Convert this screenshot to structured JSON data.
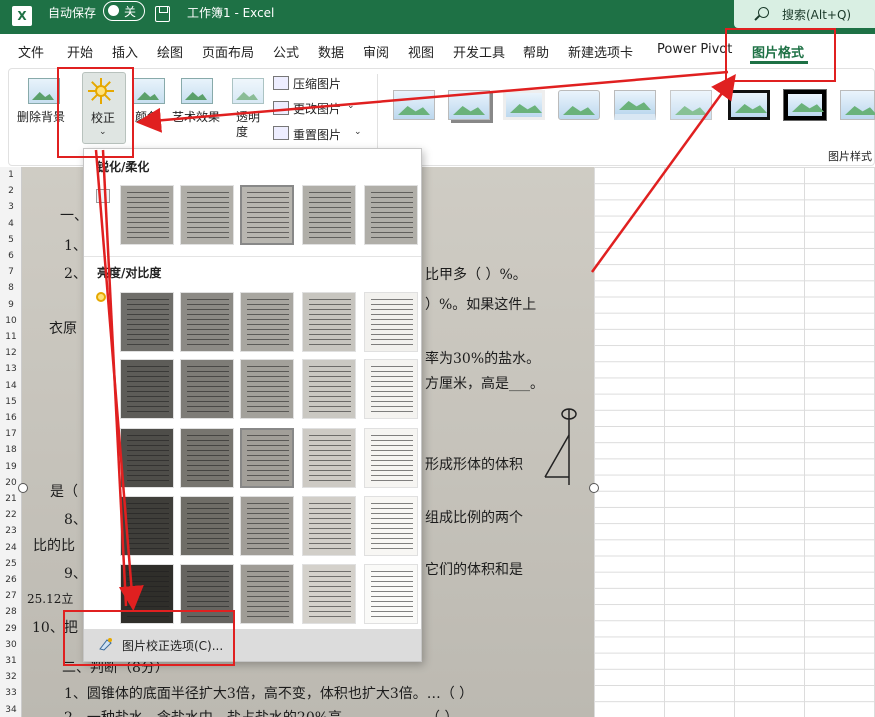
{
  "titlebar": {
    "logo": "X",
    "autosave_label": "自动保存",
    "autosave_state": "关",
    "doc_title": "工作簿1 - Excel",
    "search_label": "搜索(Alt+Q)"
  },
  "menu": {
    "tabs": [
      "文件",
      "开始",
      "插入",
      "绘图",
      "页面布局",
      "公式",
      "数据",
      "审阅",
      "视图",
      "开发工具",
      "帮助",
      "新建选项卡",
      "Power Pivot",
      "图片格式"
    ],
    "active_tab": "图片格式"
  },
  "ribbon": {
    "remove_bg": "删除背景",
    "corrections": "校正",
    "color": "颜色",
    "artistic": "艺术效果",
    "transparency_line1": "透明",
    "transparency_line2": "度",
    "compress": "压缩图片",
    "change": "更改图片",
    "reset": "重置图片",
    "styles_group": "图片样式"
  },
  "panel": {
    "sharpen_title": "锐化/柔化",
    "brightness_title": "亮度/对比度",
    "footer_label": "图片校正选项(C)..."
  },
  "sheet": {
    "row_numbers": [
      "1",
      "2",
      "3",
      "4",
      "5",
      "6",
      "7",
      "8",
      "9",
      "10",
      "11",
      "12",
      "13",
      "14",
      "15",
      "16",
      "17",
      "18",
      "19",
      "20",
      "21",
      "22",
      "23",
      "24",
      "25",
      "26",
      "27",
      "28",
      "29",
      "30",
      "31",
      "32",
      "33",
      "34"
    ]
  },
  "picture_text": {
    "l1": "一、",
    "l2": "1、",
    "l3": "2、",
    "l3b": "比甲多（ ）%。",
    "l4b": "）%。如果这件上",
    "l5": "衣原",
    "l6b": "率为30%的盐水。",
    "l7b": "方厘米，高是___。",
    "l8b": "形成形体的体积",
    "l9": "是（",
    "l10": "8、",
    "l10b": "组成比例的两个",
    "l11": "比的比",
    "l12": "9、",
    "l12b": "它们的体积和是",
    "l13": "25.12立",
    "l14": "10、把",
    "l15": "二、判断（8分）",
    "l16": "1、圆锥体的底面半径扩大3倍，高不变，体积也扩大3倍。…（ ）",
    "l17": "2、一种盐水，含盐水中，盐占盐水的20%高，……………（ ）"
  }
}
